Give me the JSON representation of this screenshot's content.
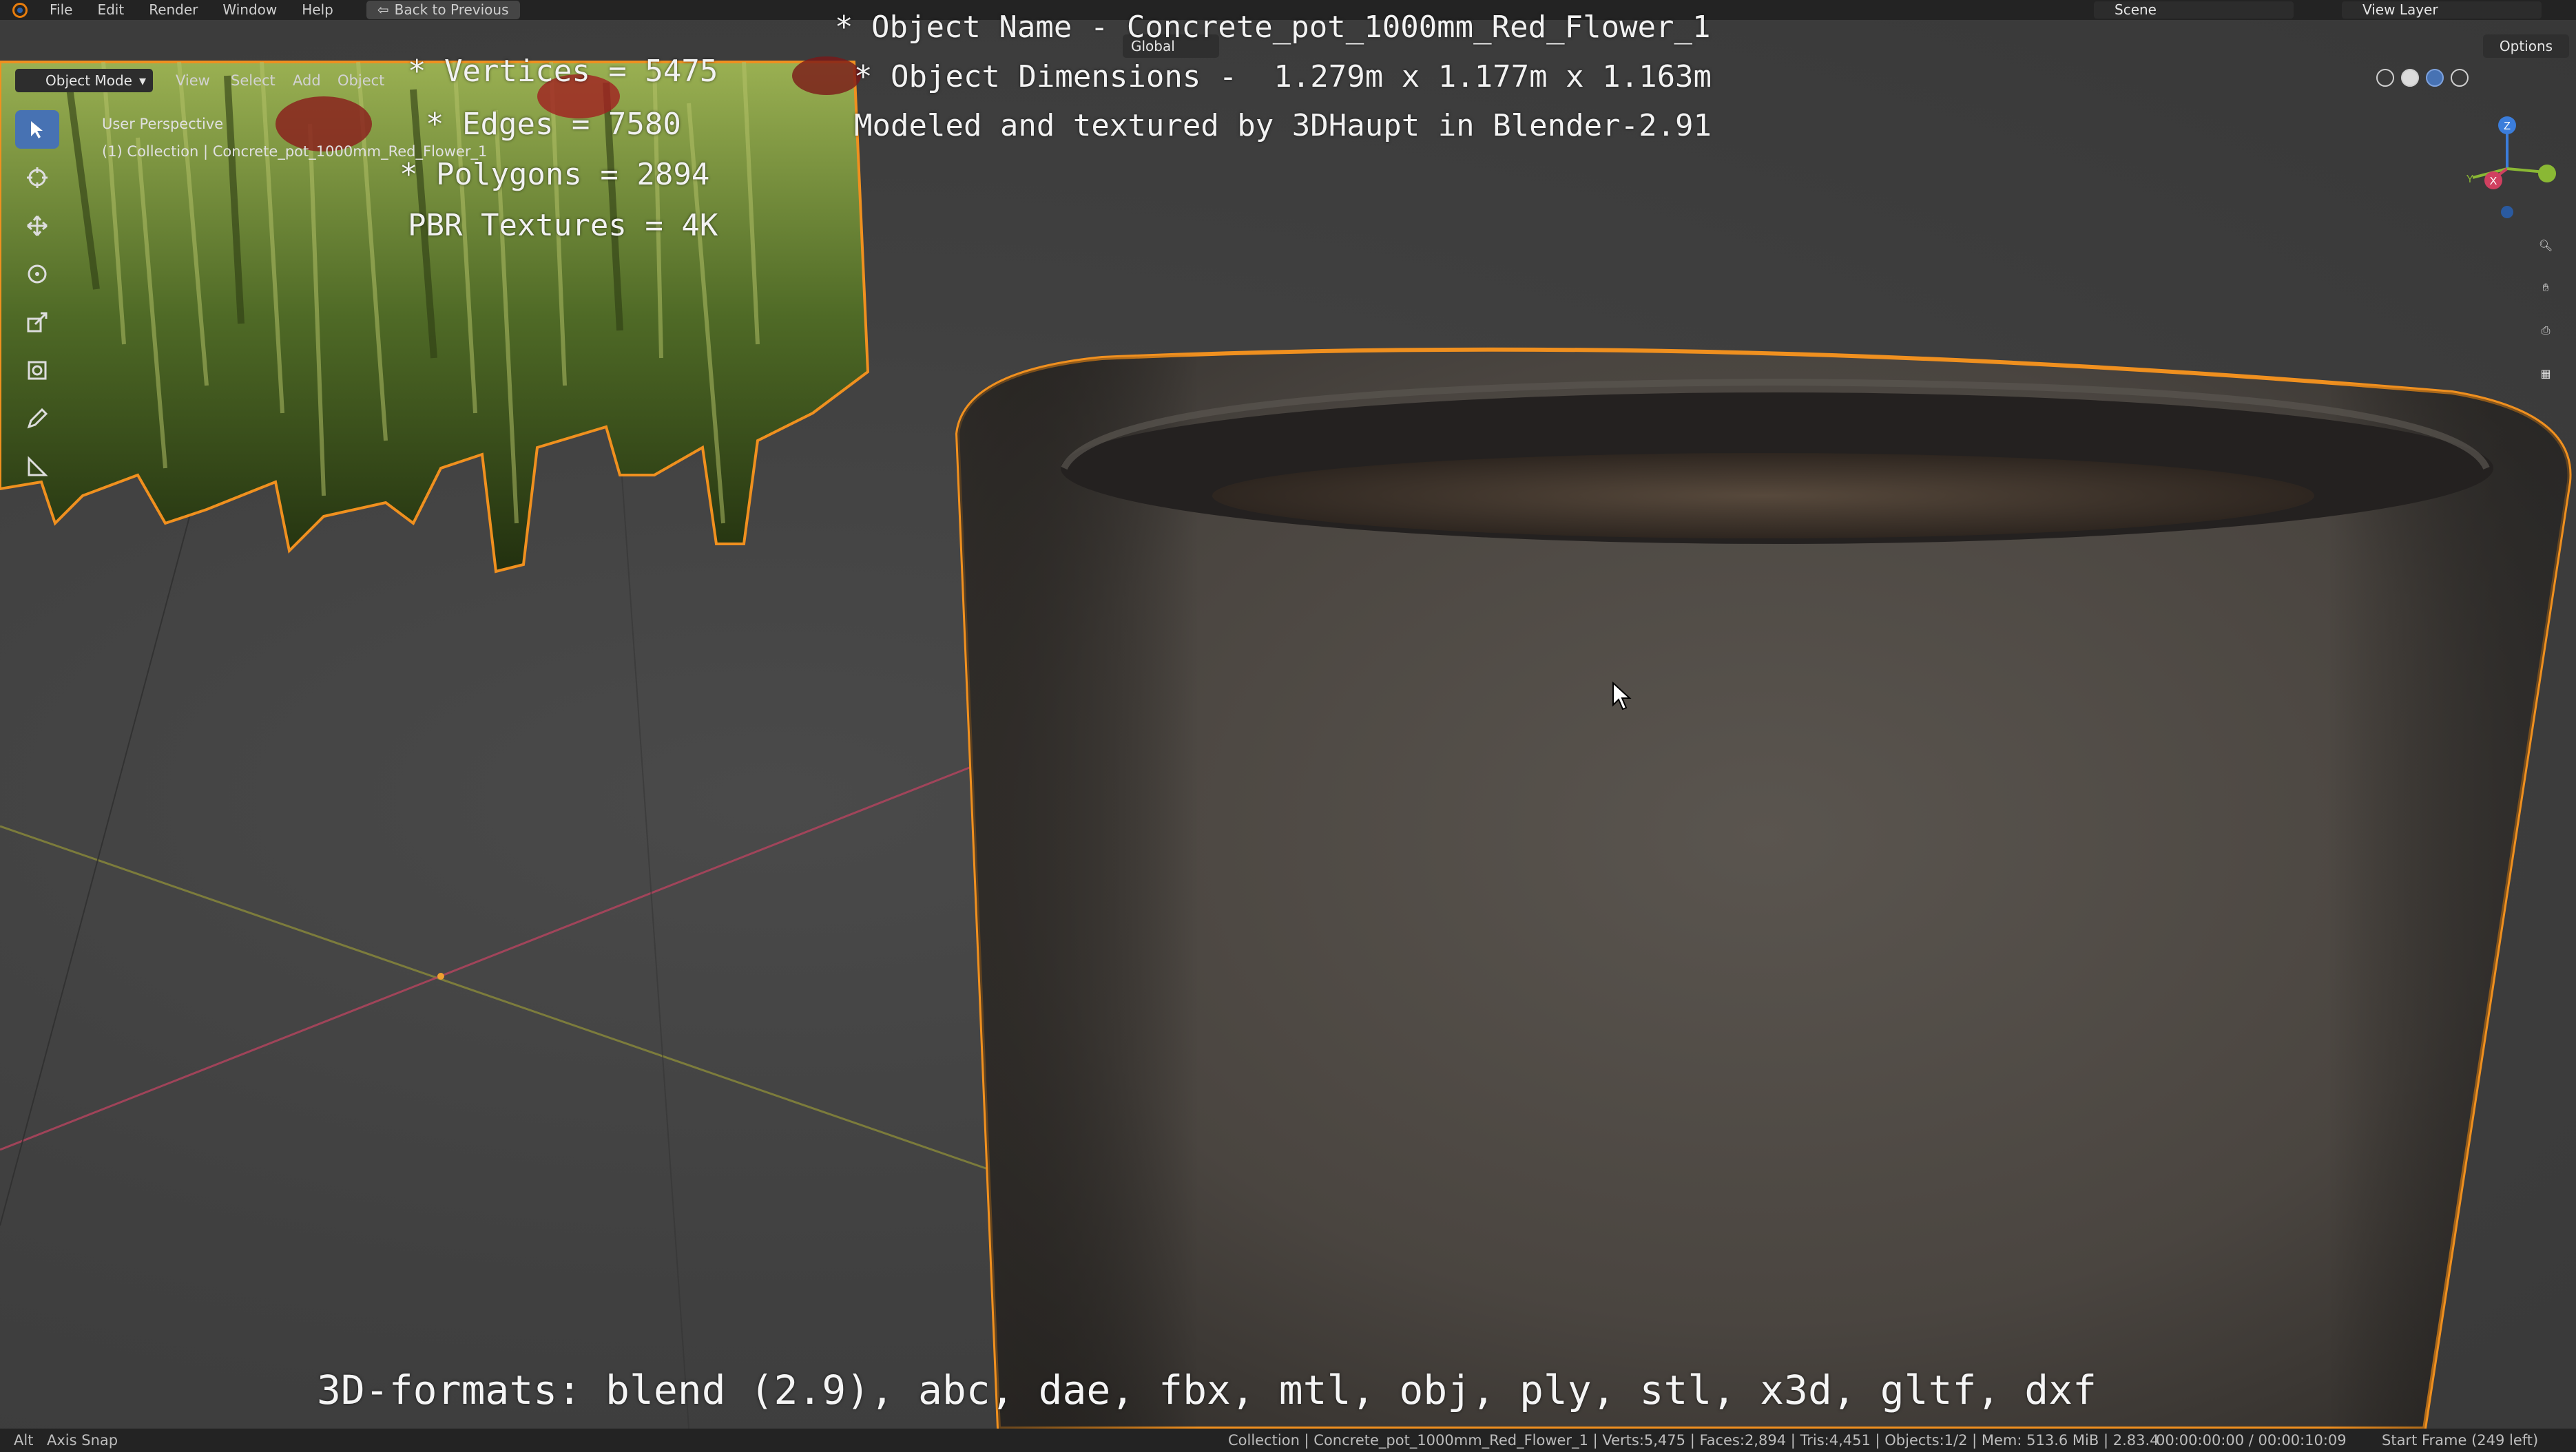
{
  "topbar": {
    "menus": [
      "File",
      "Edit",
      "Render",
      "Window",
      "Help"
    ],
    "back_button": "Back to Previous",
    "scene": "Scene",
    "view_layer": "View Layer"
  },
  "header": {
    "mode": "Object Mode",
    "menus": [
      "View",
      "Select",
      "Add",
      "Object"
    ],
    "transform_orientation": "Global",
    "options": "Options"
  },
  "viewport_info": {
    "perspective": "User Perspective",
    "collection": "(1) Collection | Concrete_pot_1000mm_Red_Flower_1"
  },
  "overlay_text": {
    "vertices": "* Vertices = 5475",
    "edges": "* Edges = 7580",
    "polygons": "* Polygons = 2894",
    "textures": "PBR Textures = 4K",
    "object_name": "* Object Name - Concrete_pot_1000mm_Red_Flower_1",
    "object_dimensions": "* Object Dimensions -  1.279m x 1.177m x 1.163m",
    "modeled_by": "Modeled and textured by 3DHaupt in Blender-2.91",
    "formats": "3D-formats: blend (2.9), abc, dae, fbx, mtl, obj, ply, stl, x3d, gltf, dxf"
  },
  "statusbar": {
    "left_key": "Alt",
    "left_action": "Axis Snap",
    "stats": "Collection | Concrete_pot_1000mm_Red_Flower_1 | Verts:5,475 | Faces:2,894 | Tris:4,451 | Objects:1/2 | Mem: 513.6 MiB | 2.83.4",
    "time": "00:00:00:00 / 00:00:10:09",
    "frame": "Start Frame (249 left)"
  },
  "gizmo_axes": [
    "Z",
    "X",
    "Y"
  ],
  "colors": {
    "accent": "#4772b3",
    "selection_outline": "#f0901f",
    "axis_x": "#d04060",
    "axis_y": "#8ab834",
    "axis_z": "#3b7ddb"
  }
}
